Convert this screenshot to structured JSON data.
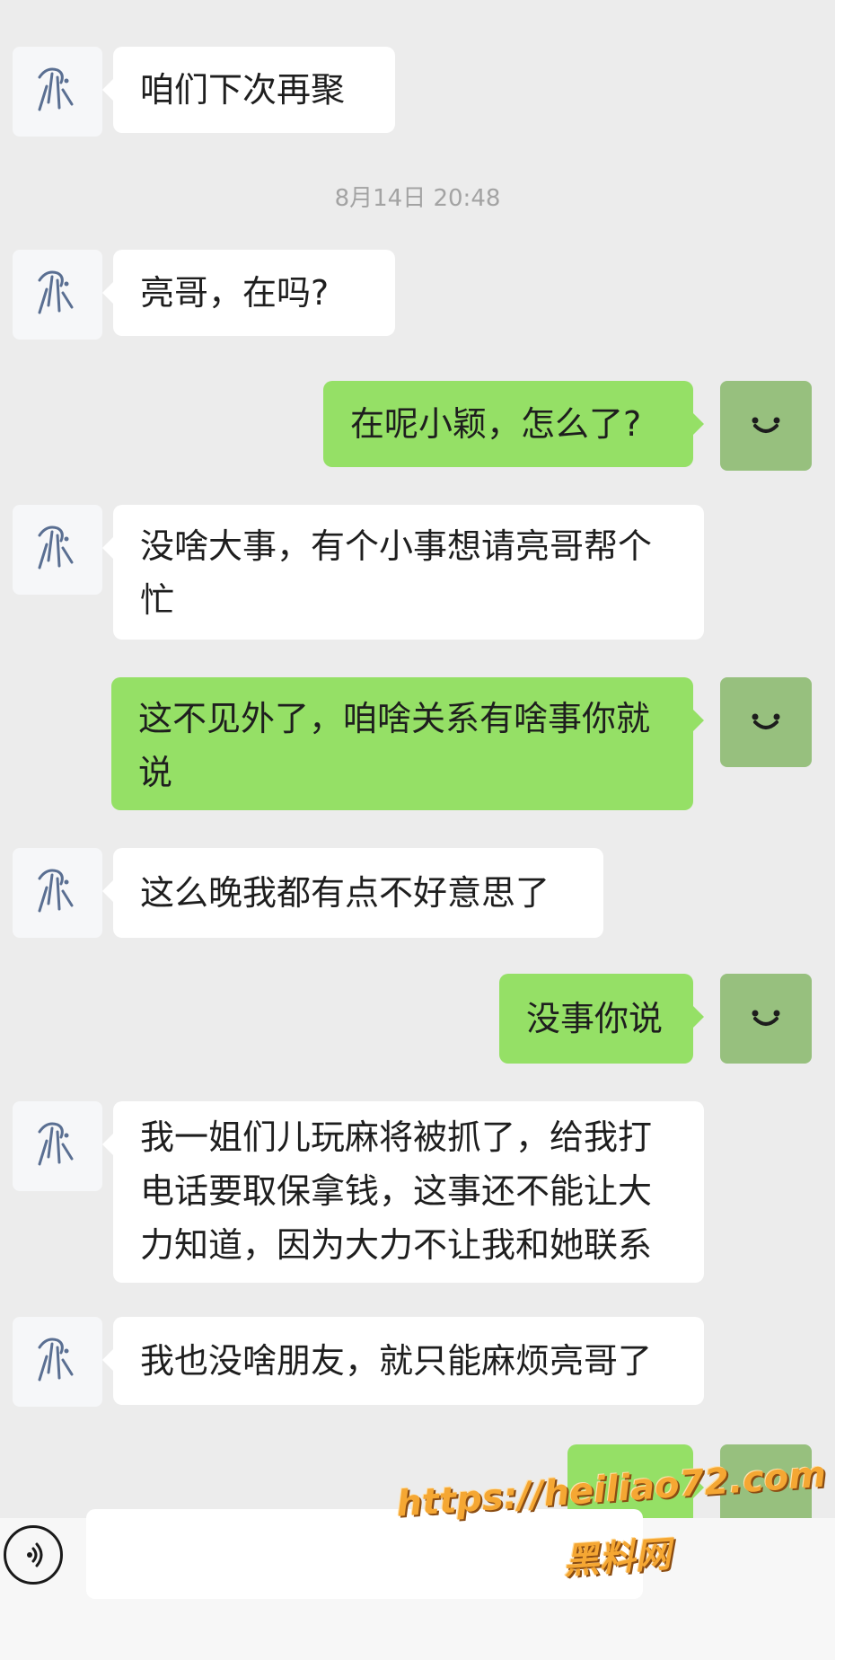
{
  "chat": {
    "timestamp": "8月14日 20:48",
    "messages": [
      {
        "from": "friend",
        "lines": [
          "咱们下次再聚"
        ]
      },
      {
        "from": "friend",
        "lines": [
          "亮哥，在吗?"
        ]
      },
      {
        "from": "me",
        "lines": [
          "在呢小颖，怎么了?"
        ]
      },
      {
        "from": "friend",
        "lines": [
          "没啥大事，有个小事想请亮哥帮个",
          "忙"
        ]
      },
      {
        "from": "me",
        "lines": [
          "这不见外了，咱啥关系有啥事你就",
          "说"
        ]
      },
      {
        "from": "friend",
        "lines": [
          "这么晚我都有点不好意思了"
        ]
      },
      {
        "from": "me",
        "lines": [
          "没事你说"
        ]
      },
      {
        "from": "friend",
        "lines": [
          "我一姐们儿玩麻将被抓了，给我打",
          "电话要取保拿钱，这事还不能让大",
          "力知道，因为大力不让我和她联系"
        ]
      },
      {
        "from": "friend",
        "lines": [
          "我也没啥朋友，就只能麻烦亮哥了"
        ]
      }
    ]
  },
  "input_bar": {
    "voice_icon": "voice-icon",
    "message_value": ""
  },
  "watermark": {
    "url": "https://heiliao72.com",
    "name": "黑料网"
  },
  "colors": {
    "chat_background": "#ececec",
    "friend_bubble": "#ffffff",
    "my_bubble": "#95e066",
    "my_avatar": "#97c07e",
    "timestamp_text": "#a3a3a3",
    "watermark": "#f5a733"
  }
}
